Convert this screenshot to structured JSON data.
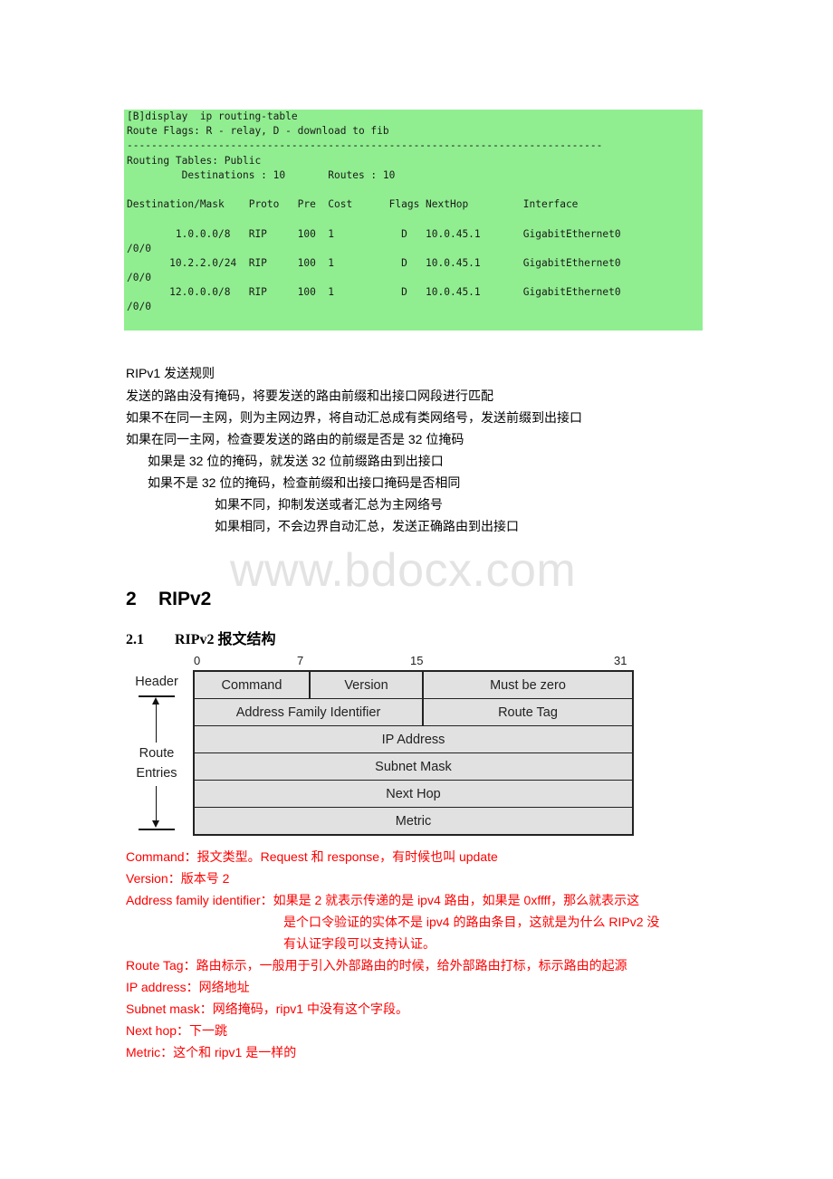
{
  "terminal": {
    "lines": [
      "[B]display  ip routing-table",
      "Route Flags: R - relay, D - download to fib",
      "------------------------------------------------------------------------------",
      "Routing Tables: Public",
      "         Destinations : 10       Routes : 10",
      "",
      "Destination/Mask    Proto   Pre  Cost      Flags NextHop         Interface",
      "",
      "        1.0.0.0/8   RIP     100  1           D   10.0.45.1       GigabitEthernet0",
      "/0/0",
      "       10.2.2.0/24  RIP     100  1           D   10.0.45.1       GigabitEthernet0",
      "/0/0",
      "       12.0.0.0/8   RIP     100  1           D   10.0.45.1       GigabitEthernet0",
      "/0/0"
    ],
    "background": "#90ee90"
  },
  "rules": {
    "title": "RIPv1 发送规则",
    "items": [
      "发送的路由没有掩码，将要发送的路由前缀和出接口网段进行匹配",
      "如果不在同一主网，则为主网边界，将自动汇总成有类网络号，发送前缀到出接口",
      "如果在同一主网，检查要发送的路由的前缀是否是 32 位掩码",
      "如果是 32 位的掩码，就发送 32 位前缀路由到出接口",
      "如果不是 32 位的掩码，检查前缀和出接口掩码是否相同",
      "如果不同，抑制发送或者汇总为主网络号",
      "如果相同，不会边界自动汇总，发送正确路由到出接口"
    ]
  },
  "watermark": "www.bdocx.com",
  "section": {
    "num": "2",
    "title": "RIPv2"
  },
  "subsection": {
    "num": "2.1",
    "title": "RIPv2 报文结构"
  },
  "diagram": {
    "bits": [
      "0",
      "7",
      "15",
      "31"
    ],
    "header_label": "Header",
    "entries_label_1": "Route",
    "entries_label_2": "Entries",
    "rows": [
      [
        "Command",
        "Version",
        "Must be zero"
      ],
      [
        "Address Family Identifier",
        "Route Tag"
      ],
      [
        "IP Address"
      ],
      [
        "Subnet Mask"
      ],
      [
        "Next Hop"
      ],
      [
        "Metric"
      ]
    ]
  },
  "fields": [
    "Command：报文类型。Request 和 response，有时候也叫 update",
    "Version：版本号 2",
    "Address family identifier：如果是 2 就表示传递的是 ipv4 路由，如果是 0xffff，那么就表示这",
    "是个口令验证的实体不是 ipv4 的路由条目，这就是为什么 RIPv2 没",
    "有认证字段可以支持认证。",
    "Route Tag：路由标示，一般用于引入外部路由的时候，给外部路由打标，标示路由的起源",
    "IP address：网络地址",
    "Subnet mask：网络掩码，ripv1 中没有这个字段。",
    "Next hop：下一跳",
    "Metric：这个和 ripv1 是一样的"
  ],
  "colors": {
    "note_red": "#ff0000",
    "cell_fill": "#e1e1e1"
  }
}
